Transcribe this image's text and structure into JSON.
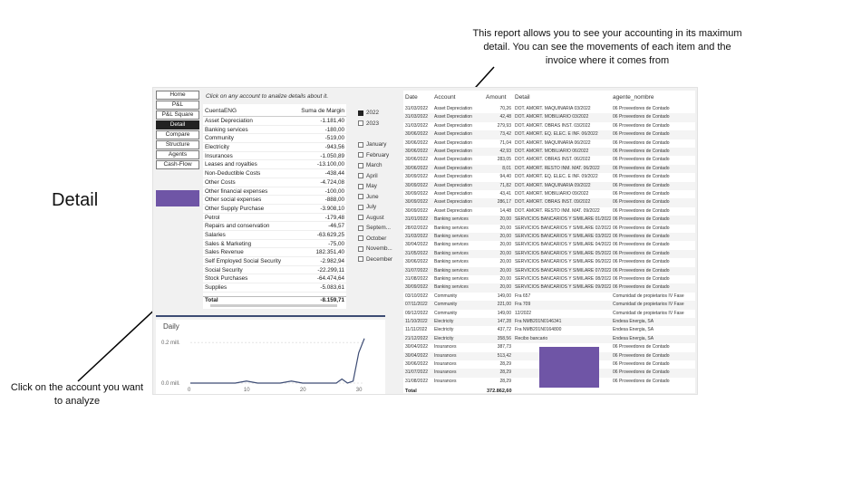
{
  "annotations": {
    "top": "This report allows you to see your accounting in its maximum detail. You can see the movements of each item and the invoice where it comes from",
    "left": "Click on the account you want to analyze",
    "side_title": "Detail"
  },
  "colors": {
    "accent": "#6f55a6",
    "nav_active": "#222222",
    "chart_line": "#3d4c74"
  },
  "nav": [
    "Home",
    "P&L",
    "P&L Square",
    "Detail",
    "Compare",
    "Structure",
    "Agents",
    "Cash-Flow"
  ],
  "hint": "Click on any account to analize details about it.",
  "accounts": {
    "headers": [
      "CuentaENG",
      "Suma de Margin"
    ],
    "rows": [
      [
        "Asset Depreciation",
        "-1.181,40"
      ],
      [
        "Banking services",
        "-180,00"
      ],
      [
        "Community",
        "-519,00"
      ],
      [
        "Electricity",
        "-943,56"
      ],
      [
        "Insurances",
        "-1.050,89"
      ],
      [
        "Leases and royalties",
        "-13.100,00"
      ],
      [
        "Non-Deductible Costs",
        "-438,44"
      ],
      [
        "Other Costs",
        "-4.724,08"
      ],
      [
        "Other financial expenses",
        "-100,00"
      ],
      [
        "Other social expenses",
        "-888,00"
      ],
      [
        "Other Supply Purchase",
        "-3.908,10"
      ],
      [
        "Petrol",
        "-179,48"
      ],
      [
        "Repairs and conservation",
        "-46,57"
      ],
      [
        "Salaries",
        "-63.629,25"
      ],
      [
        "Sales & Marketing",
        "-75,00"
      ],
      [
        "Sales Revenue",
        "182.351,40"
      ],
      [
        "Self Employed Social Security",
        "-2.982,94"
      ],
      [
        "Social Security",
        "-22.299,11"
      ],
      [
        "Stock Purchases",
        "-64.474,64"
      ],
      [
        "Supplies",
        "-5.083,61"
      ]
    ],
    "total_label": "Total",
    "total_value": "-8.159,71"
  },
  "filters": {
    "years": [
      {
        "label": "2022",
        "on": true
      },
      {
        "label": "2023",
        "on": false
      }
    ],
    "months": [
      "January",
      "February",
      "March",
      "April",
      "May",
      "June",
      "July",
      "August",
      "Septem...",
      "October",
      "Novemb...",
      "December"
    ]
  },
  "chart_data": {
    "type": "line",
    "title": "Daily",
    "x": [
      0,
      2,
      4,
      6,
      8,
      10,
      12,
      14,
      16,
      18,
      20,
      22,
      24,
      26,
      27,
      28,
      29,
      30,
      31
    ],
    "y": [
      0.0,
      0.0,
      0.0,
      0.0,
      0.0,
      0.01,
      0.0,
      0.0,
      0.0,
      0.01,
      0.0,
      0.0,
      0.0,
      0.0,
      0.02,
      0.0,
      0.01,
      0.15,
      0.22
    ],
    "xticks": [
      "0",
      "10",
      "20",
      "30"
    ],
    "yticks": [
      "0.0 mill.",
      "0.2 mill."
    ],
    "xlim": [
      0,
      31
    ],
    "ylim": [
      0,
      0.25
    ]
  },
  "movements": {
    "headers": [
      "Date",
      "Account",
      "Amount",
      "Detail",
      "agente_nombre"
    ],
    "rows": [
      [
        "31/03/2022",
        "Asset Depreciation",
        "70,26",
        "DOT. AMORT. MAQUINARIA 03/2022",
        "06 Proveedores de Contado"
      ],
      [
        "31/03/2022",
        "Asset Depreciation",
        "42,48",
        "DOT. AMORT. MOBILIARIO 03/2022",
        "06 Proveedores de Contado"
      ],
      [
        "31/03/2022",
        "Asset Depreciation",
        "279,93",
        "DOT. AMORT. OBRAS INST. 03/2022",
        "06 Proveedores de Contado"
      ],
      [
        "30/06/2022",
        "Asset Depreciation",
        "73,42",
        "DOT. AMORT. EQ. ELEC. E INF. 06/2022",
        "06 Proveedores de Contado"
      ],
      [
        "30/06/2022",
        "Asset Depreciation",
        "71,04",
        "DOT. AMORT. MAQUINARIA 06/2022",
        "06 Proveedores de Contado"
      ],
      [
        "30/06/2022",
        "Asset Depreciation",
        "42,93",
        "DOT. AMORT. MOBILIARIO 06/2022",
        "06 Proveedores de Contado"
      ],
      [
        "30/06/2022",
        "Asset Depreciation",
        "283,05",
        "DOT. AMORT. OBRAS INST. 06/2022",
        "06 Proveedores de Contado"
      ],
      [
        "30/06/2022",
        "Asset Depreciation",
        "8,01",
        "DOT. AMORT. RESTO INM. MAT. 06/2022",
        "06 Proveedores de Contado"
      ],
      [
        "30/09/2022",
        "Asset Depreciation",
        "94,40",
        "DOT. AMORT. EQ. ELEC. E INF. 09/2022",
        "06 Proveedores de Contado"
      ],
      [
        "30/09/2022",
        "Asset Depreciation",
        "71,82",
        "DOT. AMORT. MAQUINARIA 09/2022",
        "06 Proveedores de Contado"
      ],
      [
        "30/09/2022",
        "Asset Depreciation",
        "43,41",
        "DOT. AMORT. MOBILIARIO 09/2022",
        "06 Proveedores de Contado"
      ],
      [
        "30/09/2022",
        "Asset Depreciation",
        "286,17",
        "DOT. AMORT. OBRAS INST. 09/2022",
        "06 Proveedores de Contado"
      ],
      [
        "30/09/2022",
        "Asset Depreciation",
        "14,48",
        "DOT. AMORT. RESTO INM. MAT. 09/2022",
        "06 Proveedores de Contado"
      ],
      [
        "31/01/2022",
        "Banking services",
        "20,00",
        "SERVICIOS BANCARIOS Y SIMILARE 01/2022",
        "06 Proveedores de Contado"
      ],
      [
        "28/02/2022",
        "Banking services",
        "20,00",
        "SERVICIOS BANCARIOS Y SIMILARE 02/2022",
        "06 Proveedores de Contado"
      ],
      [
        "31/03/2022",
        "Banking services",
        "20,00",
        "SERVICIOS BANCARIOS Y SIMILARE 03/2022",
        "06 Proveedores de Contado"
      ],
      [
        "30/04/2022",
        "Banking services",
        "20,00",
        "SERVICIOS BANCARIOS Y SIMILARE 04/2022",
        "06 Proveedores de Contado"
      ],
      [
        "31/05/2022",
        "Banking services",
        "20,00",
        "SERVICIOS BANCARIOS Y SIMILARE 05/2022",
        "06 Proveedores de Contado"
      ],
      [
        "30/06/2022",
        "Banking services",
        "20,00",
        "SERVICIOS BANCARIOS Y SIMILARE 06/2022",
        "06 Proveedores de Contado"
      ],
      [
        "31/07/2022",
        "Banking services",
        "20,00",
        "SERVICIOS BANCARIOS Y SIMILARE 07/2022",
        "06 Proveedores de Contado"
      ],
      [
        "31/08/2022",
        "Banking services",
        "20,00",
        "SERVICIOS BANCARIOS Y SIMILARE 08/2022",
        "06 Proveedores de Contado"
      ],
      [
        "30/09/2022",
        "Banking services",
        "20,00",
        "SERVICIOS BANCARIOS Y SIMILARE 09/2022",
        "06 Proveedores de Contado"
      ],
      [
        "03/10/2022",
        "Community",
        "149,00",
        "Fra 657",
        "Comunidad de propietarios IV Fase"
      ],
      [
        "07/11/2022",
        "Community",
        "221,00",
        "Fra 709",
        "Comunidad de propietarios IV Fase"
      ],
      [
        "09/12/2022",
        "Community",
        "149,00",
        "12/2022",
        "Comunidad de propietarios IV Fase"
      ],
      [
        "11/10/2022",
        "Electricity",
        "147,28",
        "Fra NMB201N0146341",
        "Endesa Energia, SA"
      ],
      [
        "11/11/2022",
        "Electricity",
        "437,72",
        "Fra NMB201N0164800",
        "Endesa Energia, SA"
      ],
      [
        "21/12/2022",
        "Electricity",
        "358,56",
        "Recibo bancario",
        "Endesa Energia, SA"
      ],
      [
        "30/04/2022",
        "Insurances",
        "387,73",
        "",
        "06 Proveedores de Contado"
      ],
      [
        "30/04/2022",
        "Insurances",
        "513,42",
        "",
        "06 Proveedores de Contado"
      ],
      [
        "30/06/2022",
        "Insurances",
        "28,29",
        "",
        "06 Proveedores de Contado"
      ],
      [
        "31/07/2022",
        "Insurances",
        "28,29",
        "",
        "06 Proveedores de Contado"
      ],
      [
        "31/08/2022",
        "Insurances",
        "28,29",
        "",
        "06 Proveedores de Contado"
      ]
    ],
    "total_label": "Total",
    "total_value": "372.862,60"
  }
}
